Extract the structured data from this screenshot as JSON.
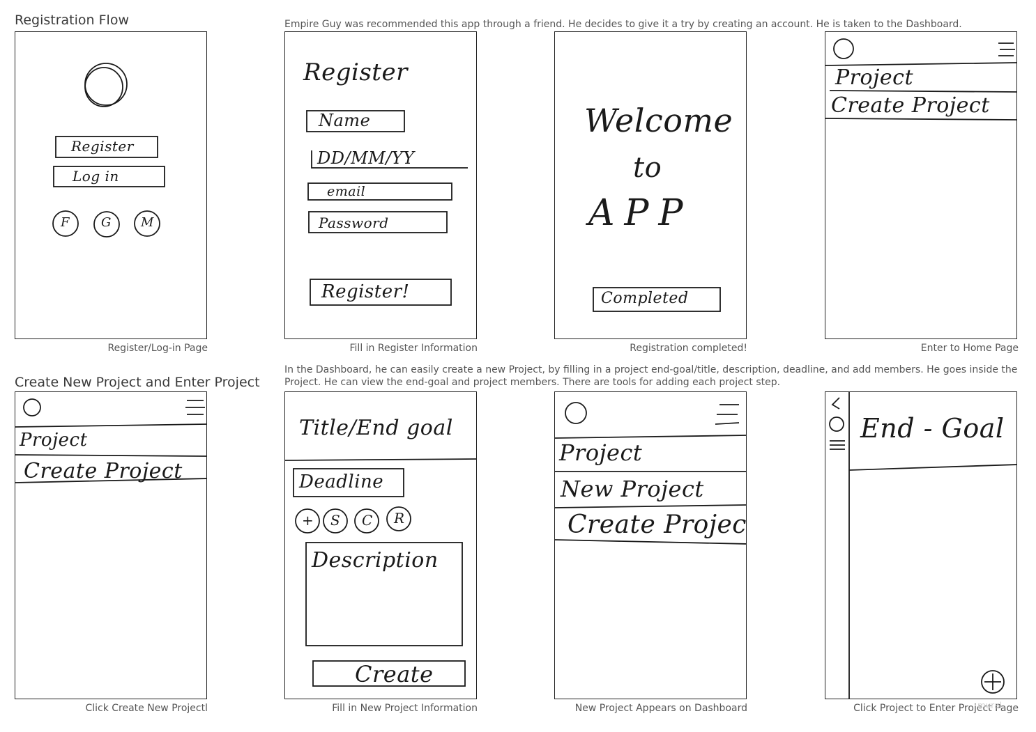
{
  "sections": [
    {
      "title": "Registration Flow",
      "narrative": "Empire Guy was recommended this app through a friend. He decides to give it a try by creating an account. He is taken to the Dashboard.",
      "captions": [
        "Register/Log-in Page",
        "Fill in Register Information",
        "Registration completed!",
        "Enter to Home Page"
      ]
    },
    {
      "title": "Create New Project and Enter Project",
      "narrative": "In the Dashboard, he can easily create a new Project, by filling in a project end-goal/title, description, deadline, and add members. He goes inside the Project. He can view the end-goal and project members. There are tools for adding each project step.",
      "captions": [
        "Click Create New Projectl",
        "Fill in New Project Information",
        "New Project Appears on Dashboard",
        "Click Project to Enter Project Page"
      ]
    }
  ],
  "sketches": {
    "login": {
      "register": "Register",
      "login": "Log in",
      "social": [
        "F",
        "G",
        "M"
      ]
    },
    "register_form": {
      "heading": "Register",
      "name": "Name",
      "dob": "DD/MM/YY",
      "email": "email",
      "password": "Password",
      "submit": "Register!"
    },
    "welcome": {
      "line1": "Welcome",
      "line2": "to",
      "line3": "APP",
      "button": "Completed"
    },
    "home": {
      "project": "Project",
      "create": "Create Project"
    },
    "home2": {
      "project": "Project",
      "create": "Create Project"
    },
    "new_project": {
      "title": "Title/End goal",
      "deadline": "Deadline",
      "members": [
        "+",
        "S",
        "C",
        "R"
      ],
      "description": "Description",
      "create": "Create"
    },
    "dashboard": {
      "project": "Project",
      "new_project": "New Project",
      "create": "Create Project"
    },
    "project_page": {
      "endgoal": "End - Goal",
      "add": "+"
    }
  },
  "watermark": "mural"
}
